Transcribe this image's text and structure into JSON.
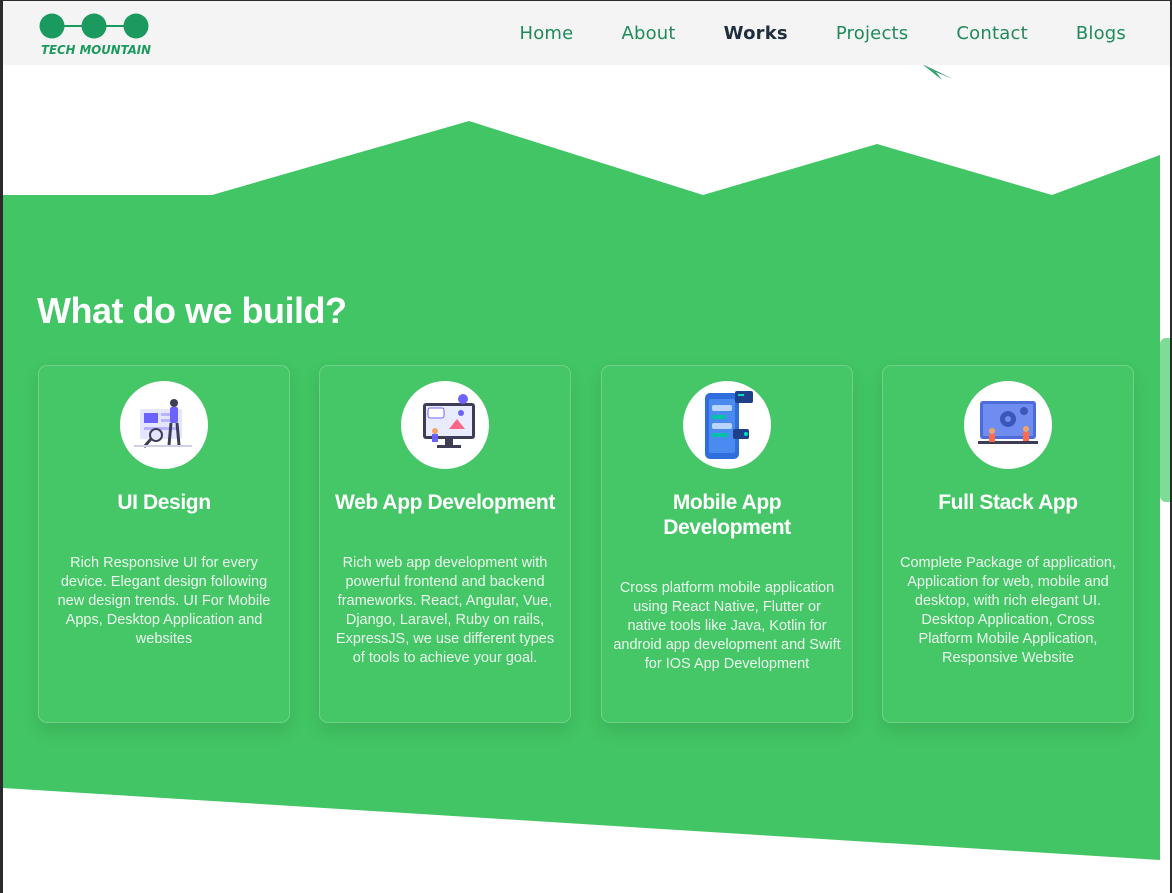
{
  "nav": {
    "logo_text": "TECH MOUNTAIN",
    "items": [
      {
        "label": "Home",
        "active": false
      },
      {
        "label": "About",
        "active": false
      },
      {
        "label": "Works",
        "active": true
      },
      {
        "label": "Projects",
        "active": false
      },
      {
        "label": "Contact",
        "active": false
      },
      {
        "label": "Blogs",
        "active": false
      }
    ]
  },
  "section": {
    "title": "What do we build?",
    "cards": [
      {
        "icon": "ui-design-illustration-icon",
        "title": "UI Design",
        "description": "Rich Responsive UI for every device. Elegant design following new design trends. UI For Mobile Apps, Desktop Application and websites"
      },
      {
        "icon": "web-app-illustration-icon",
        "title": "Web App Development",
        "description": "Rich web app development with powerful frontend and backend frameworks. React, Angular, Vue, Django, Laravel, Ruby on rails, ExpressJS, we use different types of tools to achieve your goal."
      },
      {
        "icon": "mobile-app-illustration-icon",
        "title": "Mobile App Development",
        "description": "Cross platform mobile application using React Native, Flutter or native tools like Java, Kotlin for android app development and Swift for IOS App Development"
      },
      {
        "icon": "full-stack-illustration-icon",
        "title": "Full Stack App",
        "description": "Complete Package of application, Application for web, mobile and desktop, with rich elegant UI. Desktop Application, Cross Platform Mobile Application, Responsive Website"
      }
    ]
  },
  "colors": {
    "brand_green": "#42c564",
    "nav_link": "#1f8a5a",
    "nav_active": "#1f2d3d",
    "logo_green": "#1a9a5e"
  }
}
